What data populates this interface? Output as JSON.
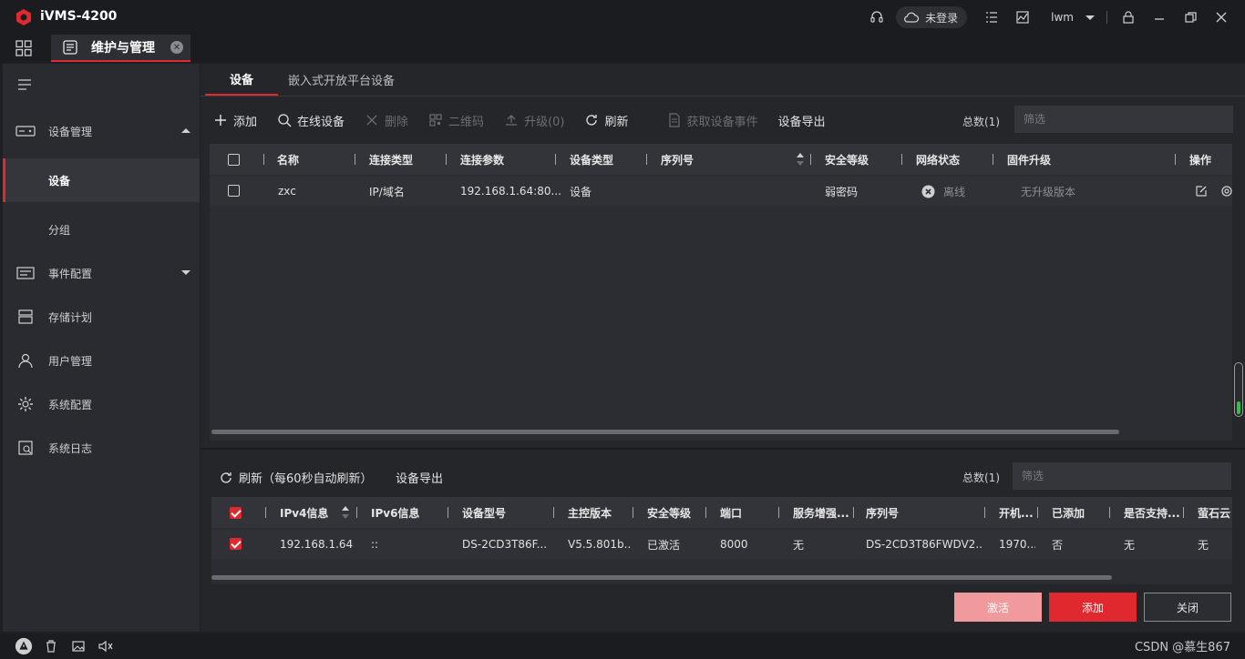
{
  "app": {
    "title": "iVMS-4200",
    "brand_color": "#e0292e"
  },
  "titlebar": {
    "login_status": "未登录",
    "username": "lwm"
  },
  "module_tab": {
    "label": "维护与管理"
  },
  "sidebar": {
    "items": [
      {
        "label": "设备管理",
        "icon": "device-icon",
        "expanded": true
      },
      {
        "label": "设备",
        "sub": true,
        "active": true
      },
      {
        "label": "分组",
        "sub": true,
        "active": false
      },
      {
        "label": "事件配置",
        "icon": "event-icon",
        "expanded": false
      },
      {
        "label": "存储计划",
        "icon": "storage-icon"
      },
      {
        "label": "用户管理",
        "icon": "user-icon"
      },
      {
        "label": "系统配置",
        "icon": "gear-icon"
      },
      {
        "label": "系统日志",
        "icon": "log-icon"
      }
    ]
  },
  "subtabs": [
    {
      "label": "设备",
      "active": true
    },
    {
      "label": "嵌入式开放平台设备",
      "active": false
    }
  ],
  "toolbar": {
    "add": "添加",
    "online": "在线设备",
    "delete": "删除",
    "qrcode": "二维码",
    "upgrade": "升级(0)",
    "refresh": "刷新",
    "get_events": "获取设备事件",
    "export": "设备导出",
    "total": "总数(1)",
    "filter_placeholder": "筛选"
  },
  "device_table": {
    "columns": [
      "名称",
      "连接类型",
      "连接参数",
      "设备类型",
      "序列号",
      "安全等级",
      "网络状态",
      "固件升级",
      "操作"
    ],
    "rows": [
      {
        "name": "zxc",
        "conn_type": "IP/域名",
        "conn_param": "192.168.1.64:80...",
        "device_type": "设备",
        "serial": "",
        "security": "弱密码",
        "network": "离线",
        "firmware": "无升级版本"
      }
    ]
  },
  "online_section": {
    "refresh": "刷新（每60秒自动刷新）",
    "export": "设备导出",
    "total": "总数(1)",
    "filter_placeholder": "筛选",
    "columns": [
      "IPv4信息",
      "IPv6信息",
      "设备型号",
      "主控版本",
      "安全等级",
      "端口",
      "服务增强...",
      "序列号",
      "开机...",
      "已添加",
      "是否支持...",
      "萤石云"
    ],
    "rows": [
      {
        "ipv4": "192.168.1.64",
        "ipv6": "::",
        "model": "DS-2CD3T86F...",
        "version": "V5.5.801b...",
        "security": "已激活",
        "port": "8000",
        "service": "无",
        "serial": "DS-2CD3T86FWDV2...",
        "boot": "1970...",
        "added": "否",
        "support": "无",
        "ezviz": "无"
      }
    ]
  },
  "buttons": {
    "activate": "激活",
    "add": "添加",
    "close": "关闭"
  },
  "watermark": "CSDN @慕生867"
}
